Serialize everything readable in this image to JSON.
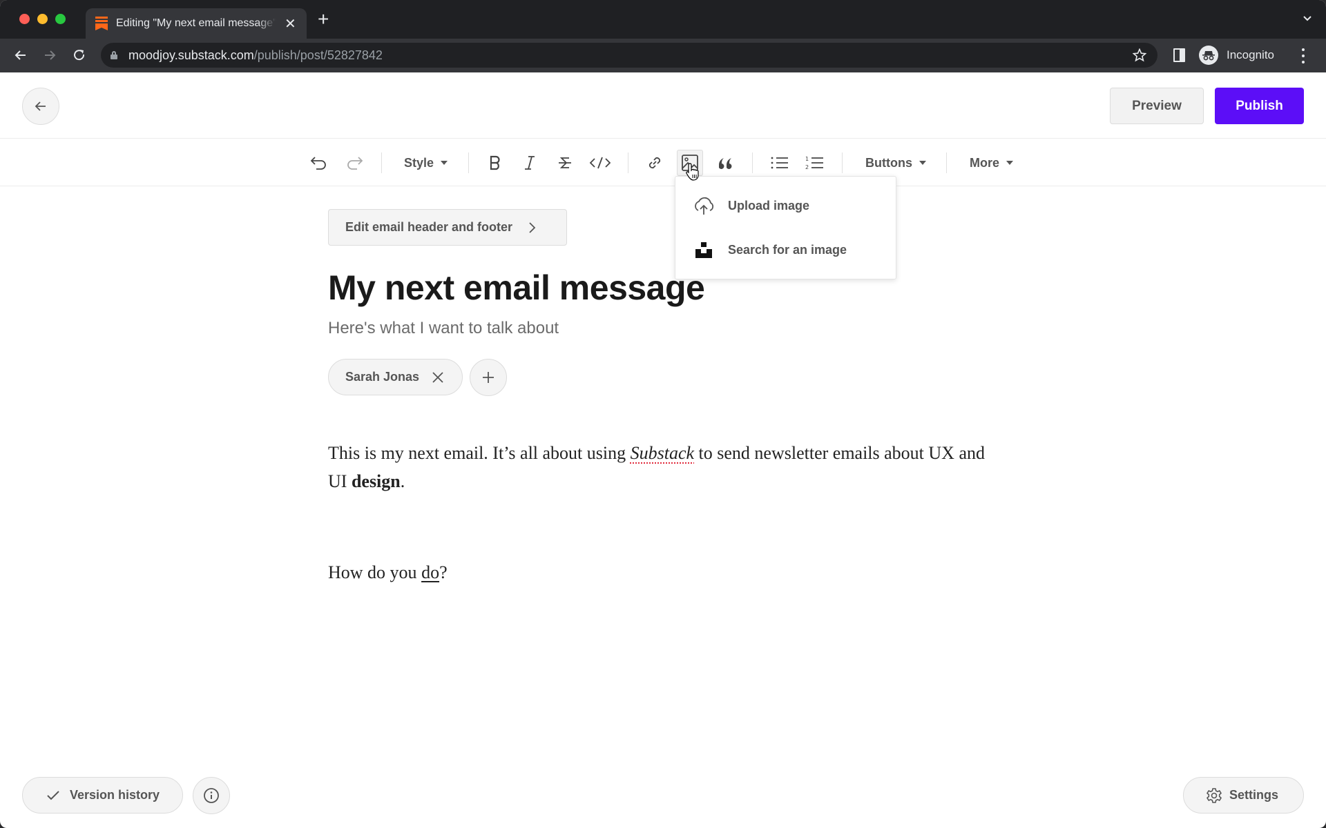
{
  "browser": {
    "tab": {
      "title": "Editing \"My next email message\"",
      "favicon": "substack-logo-icon",
      "close_icon": "close-icon"
    },
    "new_tab_icon": "plus-icon",
    "address_bar": {
      "host": "moodjoy.substack.com",
      "path": "/publish/post/52827842"
    },
    "profile_label": "Incognito",
    "colors": {
      "frame": "#1f2023",
      "toolbar": "#35363a",
      "omnibox": "#202124"
    }
  },
  "header": {
    "back_icon": "arrow-left-icon",
    "preview_label": "Preview",
    "publish_label": "Publish",
    "accent_color": "#5c0ef7"
  },
  "editor_toolbar": {
    "style_label": "Style",
    "buttons_label": "Buttons",
    "more_label": "More",
    "icons": [
      "undo-icon",
      "redo-icon",
      "bold-icon",
      "italic-icon",
      "strikethrough-icon",
      "code-icon",
      "link-icon",
      "image-icon",
      "quote-icon",
      "bullet-list-icon",
      "numbered-list-icon"
    ],
    "active_tool": "image"
  },
  "image_menu": {
    "items": [
      {
        "label": "Upload image",
        "icon": "cloud-upload-icon"
      },
      {
        "label": "Search for an image",
        "icon": "unsplash-icon"
      }
    ]
  },
  "post": {
    "edit_header_footer_label": "Edit email header and footer",
    "title": "My next email message",
    "subtitle": "Here's what I want to talk about",
    "authors": [
      "Sarah Jonas"
    ],
    "body": {
      "p1_before": "This is my next email. It’s all about using ",
      "p1_italic": "Substack",
      "p1_middle": " to send newsletter emails about UX and UI ",
      "p1_bold": "design",
      "p1_end": ".",
      "p2_before": "How do you ",
      "p2_underline": "do",
      "p2_end": "?"
    }
  },
  "footer": {
    "version_history_label": "Version history",
    "settings_label": "Settings"
  }
}
